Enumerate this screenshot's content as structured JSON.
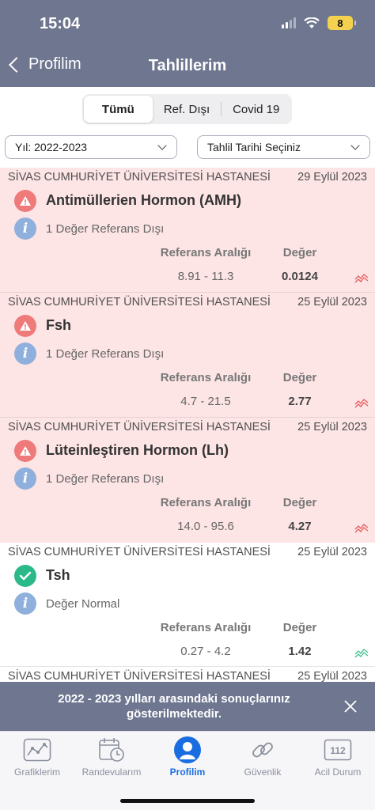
{
  "status_bar": {
    "time": "15:04",
    "battery": "8"
  },
  "nav": {
    "back_label": "Profilim",
    "title": "Tahlillerim"
  },
  "segments": [
    {
      "label": "Tümü",
      "active": true
    },
    {
      "label": "Ref. Dışı",
      "active": false
    },
    {
      "label": "Covid 19",
      "active": false
    }
  ],
  "filters": {
    "year": "Yıl: 2022-2023",
    "date": "Tahlil Tarihi Seçiniz"
  },
  "results": [
    {
      "hospital": "SİVAS CUMHURİYET ÜNİVERSİTESİ HASTANESİ",
      "date": "29 Eylül 2023",
      "test": "Antimüllerien Hormon (AMH)",
      "status": "1 Değer Referans Dışı",
      "range_header": "Referans Aralığı",
      "value_header": "Değer",
      "range": "8.91 - 11.3",
      "value": "0.0124",
      "state": "out"
    },
    {
      "hospital": "SİVAS CUMHURİYET ÜNİVERSİTESİ HASTANESİ",
      "date": "25 Eylül 2023",
      "test": "Fsh",
      "status": "1 Değer Referans Dışı",
      "range_header": "Referans Aralığı",
      "value_header": "Değer",
      "range": "4.7 - 21.5",
      "value": "2.77",
      "state": "out"
    },
    {
      "hospital": "SİVAS CUMHURİYET ÜNİVERSİTESİ HASTANESİ",
      "date": "25 Eylül 2023",
      "test": "Lüteinleştiren Hormon (Lh)",
      "status": "1 Değer Referans Dışı",
      "range_header": "Referans Aralığı",
      "value_header": "Değer",
      "range": "14.0 - 95.6",
      "value": "4.27",
      "state": "out"
    },
    {
      "hospital": "SİVAS CUMHURİYET ÜNİVERSİTESİ HASTANESİ",
      "date": "25 Eylül 2023",
      "test": "Tsh",
      "status": "Değer Normal",
      "range_header": "Referans Aralığı",
      "value_header": "Değer",
      "range": "0.27 - 4.2",
      "value": "1.42",
      "state": "normal"
    },
    {
      "hospital": "SİVAS CUMHURİYET ÜNİVERSİTESİ HASTANESİ",
      "date": "25 Eylül 2023"
    }
  ],
  "toast": {
    "text": "2022 - 2023 yılları arasındaki sonuçlarınız gösterilmektedir."
  },
  "tabs": [
    {
      "label": "Grafiklerim",
      "icon": "chart-icon",
      "active": false
    },
    {
      "label": "Randevularım",
      "icon": "calendar-clock-icon",
      "active": false
    },
    {
      "label": "Profilim",
      "icon": "profile-icon",
      "active": true
    },
    {
      "label": "Güvenlik",
      "icon": "link-icon",
      "active": false
    },
    {
      "label": "Acil Durum",
      "icon": "emergency-112-icon",
      "active": false
    }
  ],
  "emergency_number": "112",
  "colors": {
    "header": "#6e7690",
    "out_of_range_bg": "#fde4e5",
    "alert": "#ef7a7a",
    "normal": "#2bb98a",
    "active_tab": "#1a6de0"
  }
}
